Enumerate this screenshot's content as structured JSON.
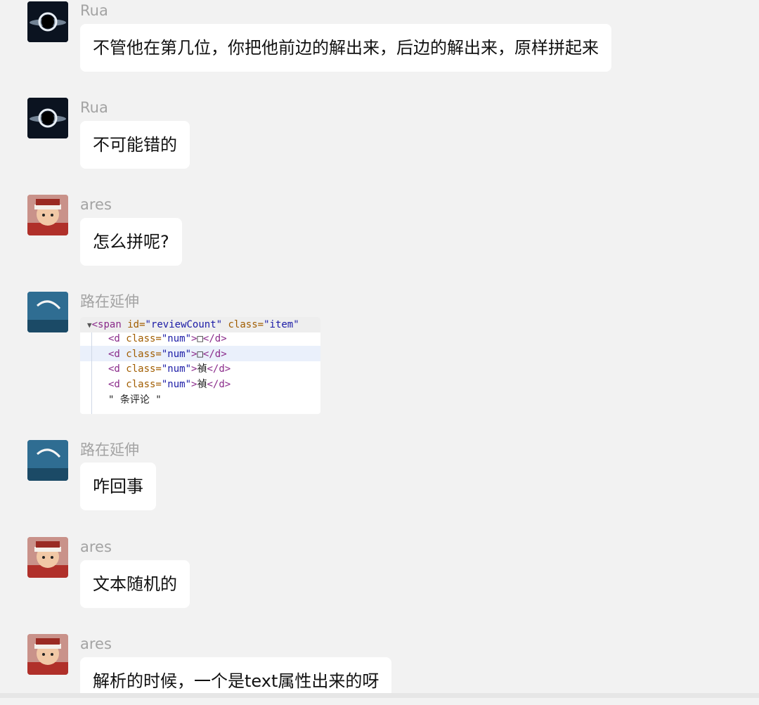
{
  "messages": [
    {
      "sender": "Rua",
      "avatar": "black-hole-avatar",
      "text": "不管他在第几位，你把他前边的解出来，后边的解出来，原样拼起来"
    },
    {
      "sender": "Rua",
      "avatar": "black-hole-avatar",
      "text": "不可能错的"
    },
    {
      "sender": "ares",
      "avatar": "anime-face-avatar",
      "text": "怎么拼呢?"
    },
    {
      "sender": "路在延伸",
      "avatar": "moon-sky-avatar",
      "image": {
        "line0_open": "<span",
        "line0_attr1": " id=",
        "line0_val1": "\"reviewCount\"",
        "line0_attr2": " class=",
        "line0_val2": "\"item\"",
        "rows": [
          {
            "open": "<d",
            "attr": " class=",
            "val": "\"num\"",
            "gt": ">",
            "glyph": "□",
            "close": "</d>"
          },
          {
            "open": "<d",
            "attr": " class=",
            "val": "\"num\"",
            "gt": ">",
            "glyph": "□",
            "close": "</d>"
          },
          {
            "open": "<d",
            "attr": " class=",
            "val": "\"num\"",
            "gt": ">",
            "glyph": "禎",
            "close": "</d>"
          },
          {
            "open": "<d",
            "attr": " class=",
            "val": "\"num\"",
            "gt": ">",
            "glyph": "禎",
            "close": "</d>"
          }
        ],
        "text_row": "\" 条评论 \""
      }
    },
    {
      "sender": "路在延伸",
      "avatar": "moon-sky-avatar",
      "text": "咋回事"
    },
    {
      "sender": "ares",
      "avatar": "anime-face-avatar",
      "text": "文本随机的"
    },
    {
      "sender": "ares",
      "avatar": "anime-face-avatar",
      "text": "解析的时候，一个是text属性出来的呀"
    }
  ],
  "colors": {
    "background": "#f2f2f2",
    "bubble": "#ffffff",
    "sender_name": "#a3a3a3",
    "message_text": "#111111"
  }
}
